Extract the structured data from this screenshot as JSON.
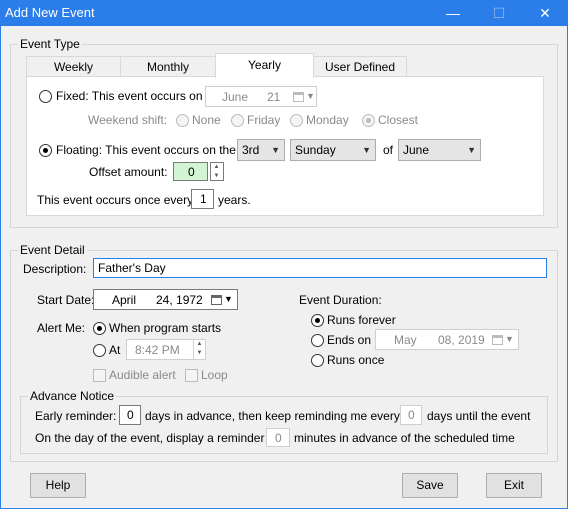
{
  "window": {
    "title": "Add New Event",
    "titlebar_color": "#2b7de9"
  },
  "event_type": {
    "label": "Event Type",
    "tabs": [
      "Weekly",
      "Monthly",
      "Yearly",
      "User Defined"
    ],
    "active_tab": "Yearly",
    "fixed": {
      "label": "Fixed: This event occurs on",
      "month": "June",
      "day": "21",
      "selected": false,
      "weekend_shift_label": "Weekend shift:",
      "weekend_options": [
        "None",
        "Friday",
        "Monday",
        "Closest"
      ],
      "weekend_selected": "Closest"
    },
    "floating": {
      "label": "Floating: This event occurs on the",
      "selected": true,
      "ordinal": "3rd",
      "weekday": "Sunday",
      "of_label": "of",
      "month": "June",
      "offset_label": "Offset amount:",
      "offset_value": "0"
    },
    "recurrence": {
      "prefix": "This event occurs once every",
      "value": "1",
      "suffix": "years."
    }
  },
  "event_detail": {
    "label": "Event Detail",
    "description_label": "Description:",
    "description_value": "Father's Day",
    "start_date_label": "Start Date:",
    "start_month": "April",
    "start_day_year": "24, 1972",
    "alert_label": "Alert Me:",
    "alert_options": {
      "when_starts": "When program starts",
      "at": "At",
      "selected": "When program starts"
    },
    "alert_time": "8:42 PM",
    "audible_alert": "Audible alert",
    "loop": "Loop",
    "duration_label": "Event Duration:",
    "duration_options": {
      "forever": "Runs forever",
      "ends_on": "Ends on",
      "once": "Runs once",
      "selected": "Runs forever"
    },
    "ends_month": "May",
    "ends_day_year": "08, 2019"
  },
  "advance_notice": {
    "label": "Advance Notice",
    "early_label": "Early reminder:",
    "early_value": "0",
    "early_mid": "days in advance, then keep reminding me every",
    "every_value": "0",
    "early_suffix": "days until the event",
    "day_of_prefix": "On the day of the event, display a reminder",
    "minutes_value": "0",
    "day_of_suffix": "minutes in advance of the scheduled time"
  },
  "buttons": {
    "help": "Help",
    "save": "Save",
    "exit": "Exit"
  }
}
